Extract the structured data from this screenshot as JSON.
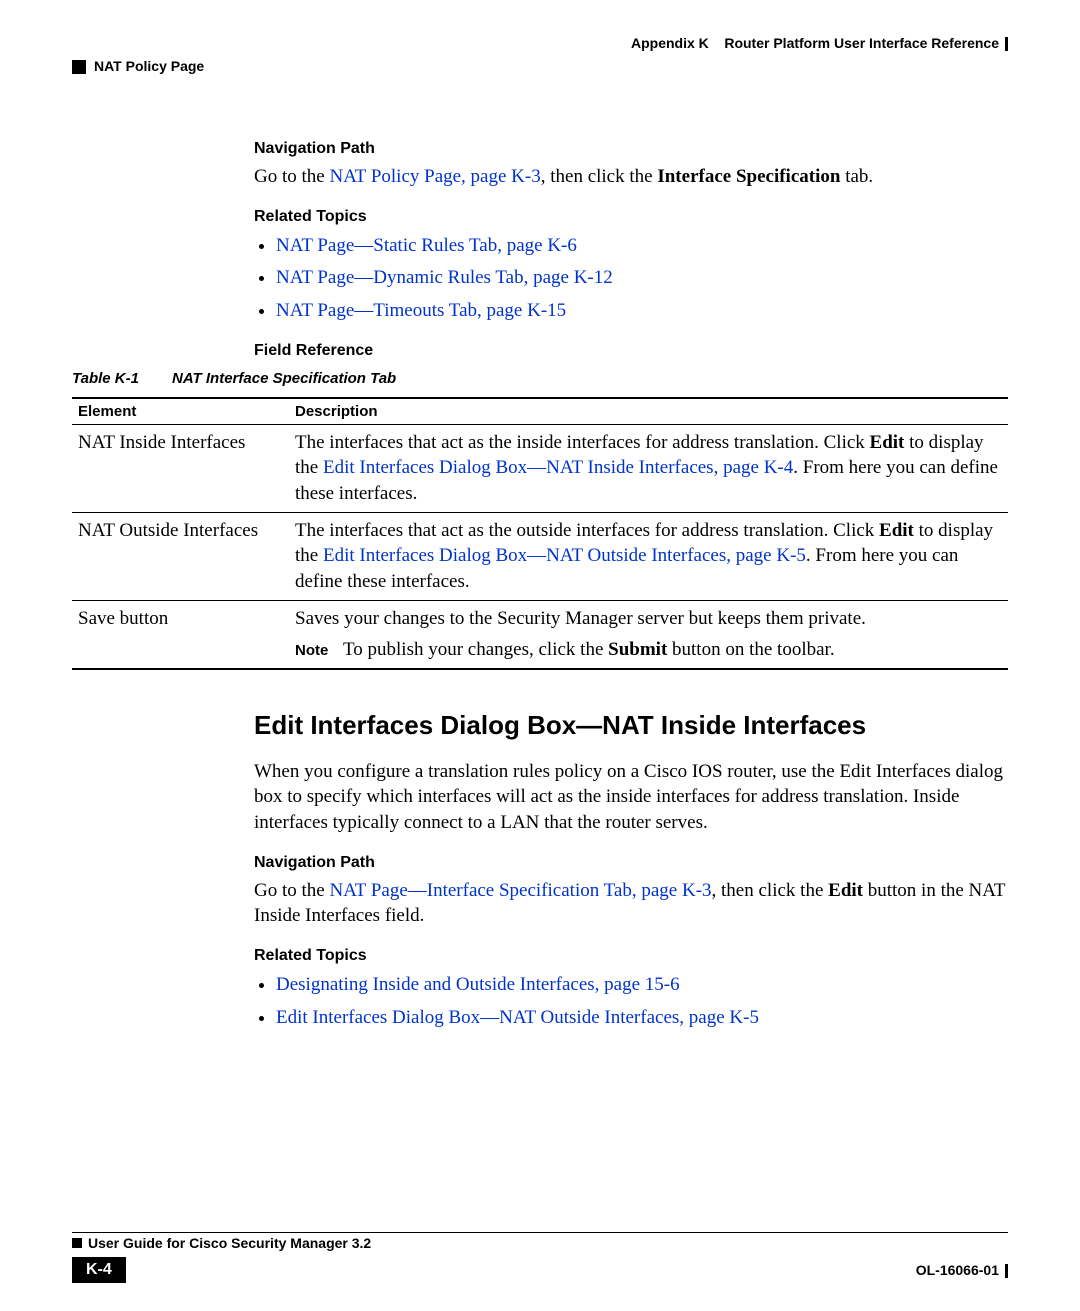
{
  "header": {
    "appendix_label": "Appendix K",
    "appendix_title": "Router Platform User Interface Reference",
    "breadcrumb": "NAT Policy Page"
  },
  "section1": {
    "navpath_heading": "Navigation Path",
    "navpath_pre": "Go to the ",
    "navpath_link": "NAT Policy Page, page K-3",
    "navpath_mid": ", then click the ",
    "navpath_bold": "Interface Specification",
    "navpath_post": " tab.",
    "related_heading": "Related Topics",
    "related_links": [
      "NAT Page—Static Rules Tab, page K-6",
      "NAT Page—Dynamic Rules Tab, page K-12",
      "NAT Page—Timeouts Tab, page K-15"
    ],
    "fieldref_heading": "Field Reference",
    "table_number": "Table K-1",
    "table_title": "NAT Interface Specification Tab",
    "table": {
      "col1": "Element",
      "col2": "Description",
      "rows": [
        {
          "element": "NAT Inside Interfaces",
          "desc_pre": "The interfaces that act as the inside interfaces for address translation. Click ",
          "desc_bold": "Edit",
          "desc_mid": " to display the ",
          "desc_link": "Edit Interfaces Dialog Box—NAT Inside Interfaces, page K-4",
          "desc_post": ". From here you can define these interfaces."
        },
        {
          "element": "NAT Outside Interfaces",
          "desc_pre": "The interfaces that act as the outside interfaces for address translation. Click ",
          "desc_bold": "Edit",
          "desc_mid": " to display the ",
          "desc_link": "Edit Interfaces Dialog Box—NAT Outside Interfaces, page K-5",
          "desc_post": ". From here you can define these interfaces."
        },
        {
          "element": "Save button",
          "save_line": "Saves your changes to the Security Manager server but keeps them private.",
          "note_label": "Note",
          "note_text_pre": "To publish your changes, click the ",
          "note_bold": "Submit",
          "note_text_post": " button on the toolbar."
        }
      ]
    }
  },
  "section2": {
    "heading": "Edit Interfaces Dialog Box—NAT Inside Interfaces",
    "intro": "When you configure a translation rules policy on a Cisco IOS router, use the Edit Interfaces dialog box to specify which interfaces will act as the inside interfaces for address translation. Inside interfaces typically connect to a LAN that the router serves.",
    "navpath_heading": "Navigation Path",
    "navpath_pre": "Go to the ",
    "navpath_link": "NAT Page—Interface Specification Tab, page K-3",
    "navpath_mid": ", then click the ",
    "navpath_bold": "Edit",
    "navpath_post": " button in the NAT Inside Interfaces field.",
    "related_heading": "Related Topics",
    "related_links": [
      "Designating Inside and Outside Interfaces, page 15-6",
      "Edit Interfaces Dialog Box—NAT Outside Interfaces, page K-5"
    ]
  },
  "footer": {
    "guide_title": "User Guide for Cisco Security Manager 3.2",
    "page_number": "K-4",
    "doc_id": "OL-16066-01"
  }
}
